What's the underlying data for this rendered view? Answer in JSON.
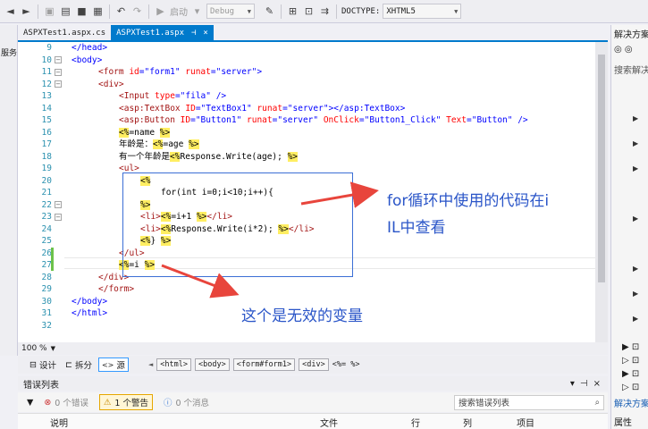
{
  "toolbar": {
    "start_label": "启动",
    "config_value": "Debug",
    "doctype_label": "DOCTYPE:",
    "doctype_value": "XHTML5"
  },
  "tabs": [
    {
      "label": "ASPXTest1.aspx.cs",
      "active": false
    },
    {
      "label": "ASPXTest1.aspx",
      "active": true,
      "pin": "⊣",
      "close": "×"
    }
  ],
  "left_panel": {
    "label": "服务"
  },
  "editor": {
    "line_numbers": [
      "9",
      "10",
      "11",
      "12",
      "13",
      "14",
      "15",
      "16",
      "17",
      "18",
      "19",
      "20",
      "21",
      "22",
      "23",
      "24",
      "25",
      "26",
      "27",
      "28",
      "29",
      "30",
      "31",
      "32"
    ],
    "lines": {
      "l9": "</head>",
      "l10": "<body>",
      "l11a": "<form ",
      "l11b": "id",
      "l11c": "=\"form1\" ",
      "l11d": "runat",
      "l11e": "=\"server\">",
      "l12": "<div>",
      "l13a": "<Input ",
      "l13b": "type",
      "l13c": "=\"fila\" />",
      "l14a": "<asp:TextBox ",
      "l14b": "ID",
      "l14c": "=\"TextBox1\" ",
      "l14d": "runat",
      "l14e": "=\"server\"></asp:TextBox>",
      "l15a": "<asp:Button ",
      "l15b": "ID",
      "l15c": "=\"Button1\" ",
      "l15d": "runat",
      "l15e": "=\"server\" ",
      "l15f": "OnClick",
      "l15g": "=\"Button1_Click\" ",
      "l15h": "Text",
      "l15i": "=\"Button\" />",
      "l16a": "<%",
      "l16b": "=name ",
      "l16c": "%>",
      "l17a": "年龄是：",
      "l17b": "<%",
      "l17c": "=age ",
      "l17d": "%>",
      "l18a": "有一个年龄是",
      "l18b": "<%",
      "l18c": "Response.Write(age); ",
      "l18d": "%>",
      "l19": "<ul>",
      "l20": "<%",
      "l21": "for(int i=0;i<10;i++){",
      "l22": "%>",
      "l23a": "<li>",
      "l23b": "<%",
      "l23c": "=i+1 ",
      "l23d": "%>",
      "l23e": "</li>",
      "l24a": "<li>",
      "l24b": "<%",
      "l24c": "Response.Write(i*2); ",
      "l24d": "%>",
      "l24e": "</li>",
      "l25a": "<%",
      "l25b": "} ",
      "l25c": "%>",
      "l26": "</ul>",
      "l27a": "<%",
      "l27b": "=i ",
      "l27c": "%>",
      "l28": "</div>",
      "l29": "</form>",
      "l30": "</body>",
      "l31": "</html>"
    }
  },
  "annotations": {
    "note1_line1": "for循环中使用的代码在i",
    "note1_line2": "IL中查看",
    "note2": "这个是无效的变量",
    "color": "#2a55c8",
    "box_color": "#3b6fd6",
    "arrow_color": "#e8453c"
  },
  "zoom": "100 %",
  "viewbar": {
    "design": "设计",
    "split": "拆分",
    "source": "源",
    "crumbs": [
      "<html>",
      "<body>",
      "<form#form1>",
      "<div>"
    ],
    "last_crumb": "<%= %>"
  },
  "error_list": {
    "title": "错误列表",
    "errors": "0 个错误",
    "warnings": "1 个警告",
    "messages": "0 个消息",
    "search_placeholder": "搜索错误列表",
    "columns": [
      "说明",
      "文件",
      "行",
      "列",
      "项目"
    ]
  },
  "right_panel": {
    "title": "解决方案",
    "search": "搜索解决",
    "bottom_title": "解决方案",
    "properties": "属性"
  }
}
